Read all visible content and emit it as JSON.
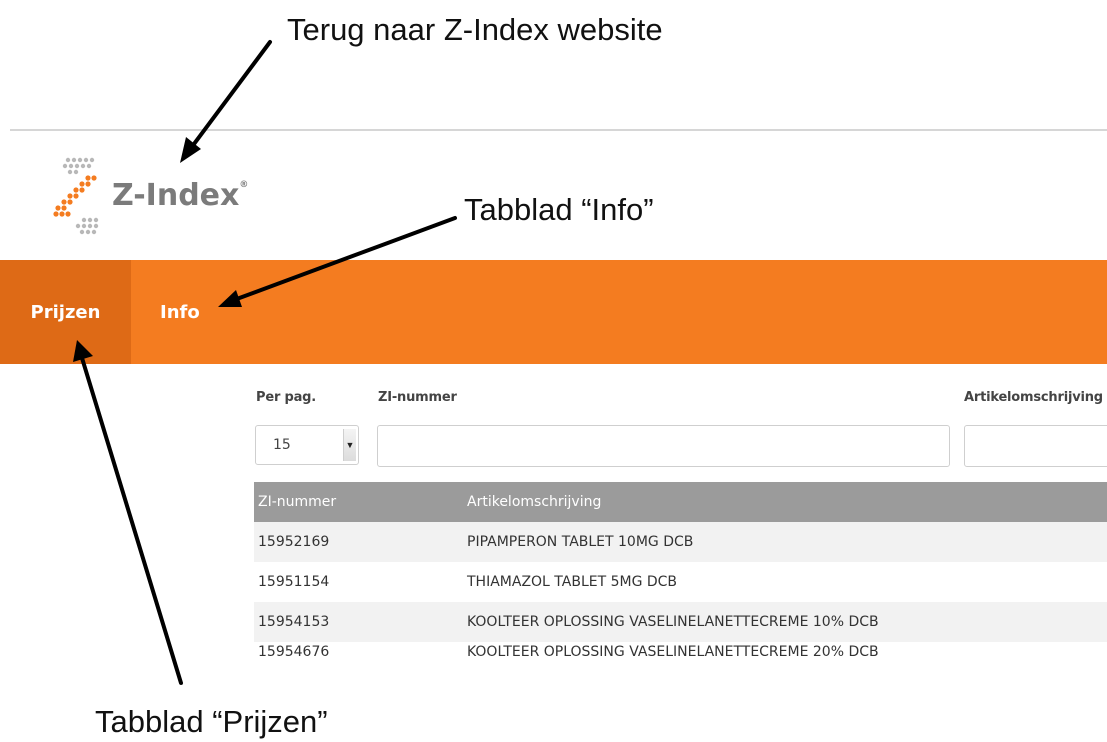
{
  "annotations": {
    "back_to_website": "Terug naar Z-Index website",
    "tab_info": "Tabblad “Info”",
    "tab_prijzen": "Tabblad “Prijzen”"
  },
  "logo": {
    "text": "Z-Index",
    "reg_mark": "®"
  },
  "nav": {
    "tabs": [
      {
        "label": "Prijzen",
        "active": true
      },
      {
        "label": "Info",
        "active": false
      }
    ]
  },
  "filters": {
    "per_page_label": "Per pag.",
    "per_page_value": "15",
    "zi_number_label": "ZI-nummer",
    "zi_number_value": "",
    "article_label": "Artikelomschrijving",
    "article_value": ""
  },
  "table": {
    "columns": [
      "ZI-nummer",
      "Artikelomschrijving"
    ],
    "rows": [
      [
        "15952169",
        "PIPAMPERON TABLET 10MG DCB"
      ],
      [
        "15951154",
        "THIAMAZOL TABLET 5MG DCB"
      ],
      [
        "15954153",
        "KOOLTEER OPLOSSING VASELINELANETTECREME 10% DCB"
      ],
      [
        "15954676",
        "KOOLTEER OPLOSSING VASELINELANETTECREME 20% DCB"
      ]
    ]
  },
  "colors": {
    "nav_bg": "#f47c20",
    "nav_active_bg": "#de6a16",
    "table_header_bg": "#9b9b9b"
  },
  "icons": {
    "select_arrow": "caret-down-icon"
  }
}
